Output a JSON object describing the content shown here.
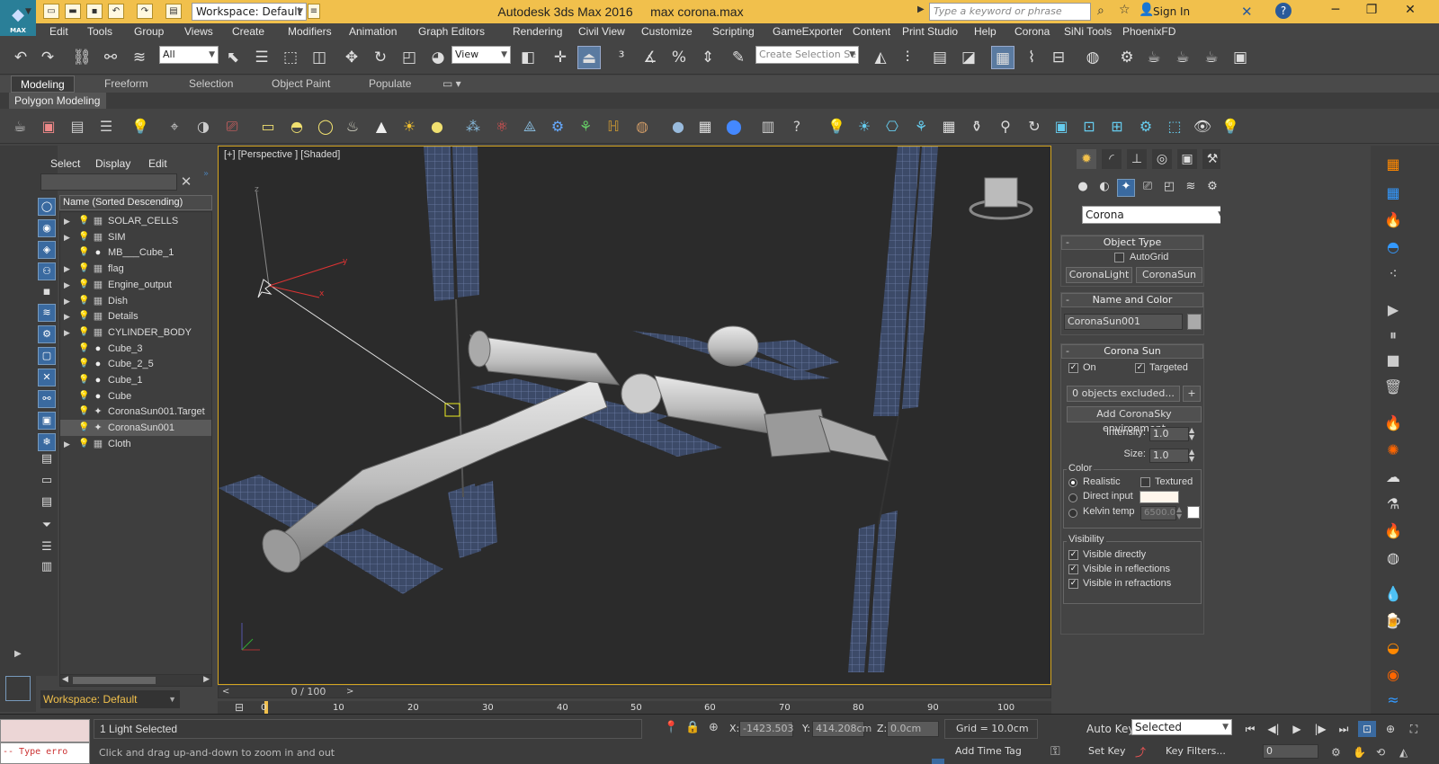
{
  "app": {
    "title": "Autodesk 3ds Max 2016",
    "file": "max corona.max",
    "logo_text": "MAX"
  },
  "titlebar": {
    "workspace": "Workspace: Default",
    "search_placeholder": "Type a keyword or phrase",
    "sign_in": "Sign In"
  },
  "menu": [
    "Edit",
    "Tools",
    "Group",
    "Views",
    "Create",
    "Modifiers",
    "Animation",
    "Graph Editors",
    "Rendering",
    "Civil View",
    "Customize",
    "Scripting",
    "GameExporter",
    "Content",
    "Print Studio",
    "Help",
    "Corona",
    "SiNi Tools",
    "PhoenixFD"
  ],
  "toolbar": {
    "filter": "All",
    "view": "View",
    "selection_set": "Create Selection Se"
  },
  "ribbon": {
    "tabs": [
      "Modeling",
      "Freeform",
      "Selection",
      "Object Paint",
      "Populate"
    ],
    "active": "Modeling",
    "sub": "Polygon Modeling"
  },
  "scene_explorer": {
    "menu": [
      "Select",
      "Display",
      "Edit"
    ],
    "column": "Name (Sorted Descending)",
    "rows": [
      {
        "name": "SOLAR_CELLS",
        "expand": "▶",
        "type": "group"
      },
      {
        "name": "SIM",
        "expand": "▶",
        "type": "group"
      },
      {
        "name": "MB___Cube_1",
        "expand": "",
        "type": "mesh"
      },
      {
        "name": "flag",
        "expand": "▶",
        "type": "group"
      },
      {
        "name": "Engine_output",
        "expand": "▶",
        "type": "group"
      },
      {
        "name": "Dish",
        "expand": "▶",
        "type": "group"
      },
      {
        "name": "Details",
        "expand": "▶",
        "type": "group"
      },
      {
        "name": "CYLINDER_BODY",
        "expand": "▶",
        "type": "group"
      },
      {
        "name": "Cube_3",
        "expand": "",
        "type": "mesh"
      },
      {
        "name": "Cube_2_5",
        "expand": "",
        "type": "mesh"
      },
      {
        "name": "Cube_1",
        "expand": "",
        "type": "mesh"
      },
      {
        "name": "Cube",
        "expand": "",
        "type": "mesh"
      },
      {
        "name": "CoronaSun001.Target",
        "expand": "",
        "type": "light"
      },
      {
        "name": "CoronaSun001",
        "expand": "",
        "type": "light",
        "selected": true
      },
      {
        "name": "Cloth",
        "expand": "▶",
        "type": "group"
      }
    ],
    "workspace": "Workspace: Default"
  },
  "viewport": {
    "label": "[+] [Perspective ] [Shaded]",
    "frame": "0 / 100"
  },
  "timeline": {
    "ticks": [
      "0",
      "10",
      "20",
      "30",
      "40",
      "50",
      "60",
      "70",
      "80",
      "90",
      "100"
    ]
  },
  "command_panel": {
    "category": "Corona",
    "object_type": {
      "title": "Object Type",
      "autogrid": "AutoGrid",
      "btn1": "CoronaLight",
      "btn2": "CoronaSun"
    },
    "name_color": {
      "title": "Name and Color",
      "name": "CoronaSun001"
    },
    "corona_sun": {
      "title": "Corona Sun",
      "on": "On",
      "targeted": "Targeted",
      "excluded": "0 objects excluded...",
      "plus": "+",
      "add_sky": "Add CoronaSky environment",
      "intensity_label": "Intensity:",
      "intensity": "1.0",
      "size_label": "Size:",
      "size": "1.0",
      "color_title": "Color",
      "realistic": "Realistic",
      "textured": "Textured",
      "direct_input": "Direct input",
      "kelvin": "Kelvin temp",
      "kelvin_value": "6500.0",
      "visibility_title": "Visibility",
      "vis_directly": "Visible directly",
      "vis_reflections": "Visible in reflections",
      "vis_refractions": "Visible in refractions"
    }
  },
  "status": {
    "selection": "1 Light Selected",
    "prompt": "Click and drag up-and-down to zoom in and out",
    "x_label": "X:",
    "x": "-1423.503",
    "y_label": "Y:",
    "y": "414.208cm",
    "z_label": "Z:",
    "z": "0.0cm",
    "grid": "Grid = 10.0cm",
    "autokey": "Auto Key",
    "selected": "Selected",
    "setkey": "Set Key",
    "keyfilters": "Key Filters...",
    "add_time_tag": "Add Time Tag",
    "frame": "0",
    "maxscript_error": "-- Type erro"
  },
  "colors": {
    "accent": "#f1c04c",
    "viewport_bg": "#2b2b2b",
    "panel_bg": "#444444",
    "selection_blue": "#3a6aa0"
  }
}
